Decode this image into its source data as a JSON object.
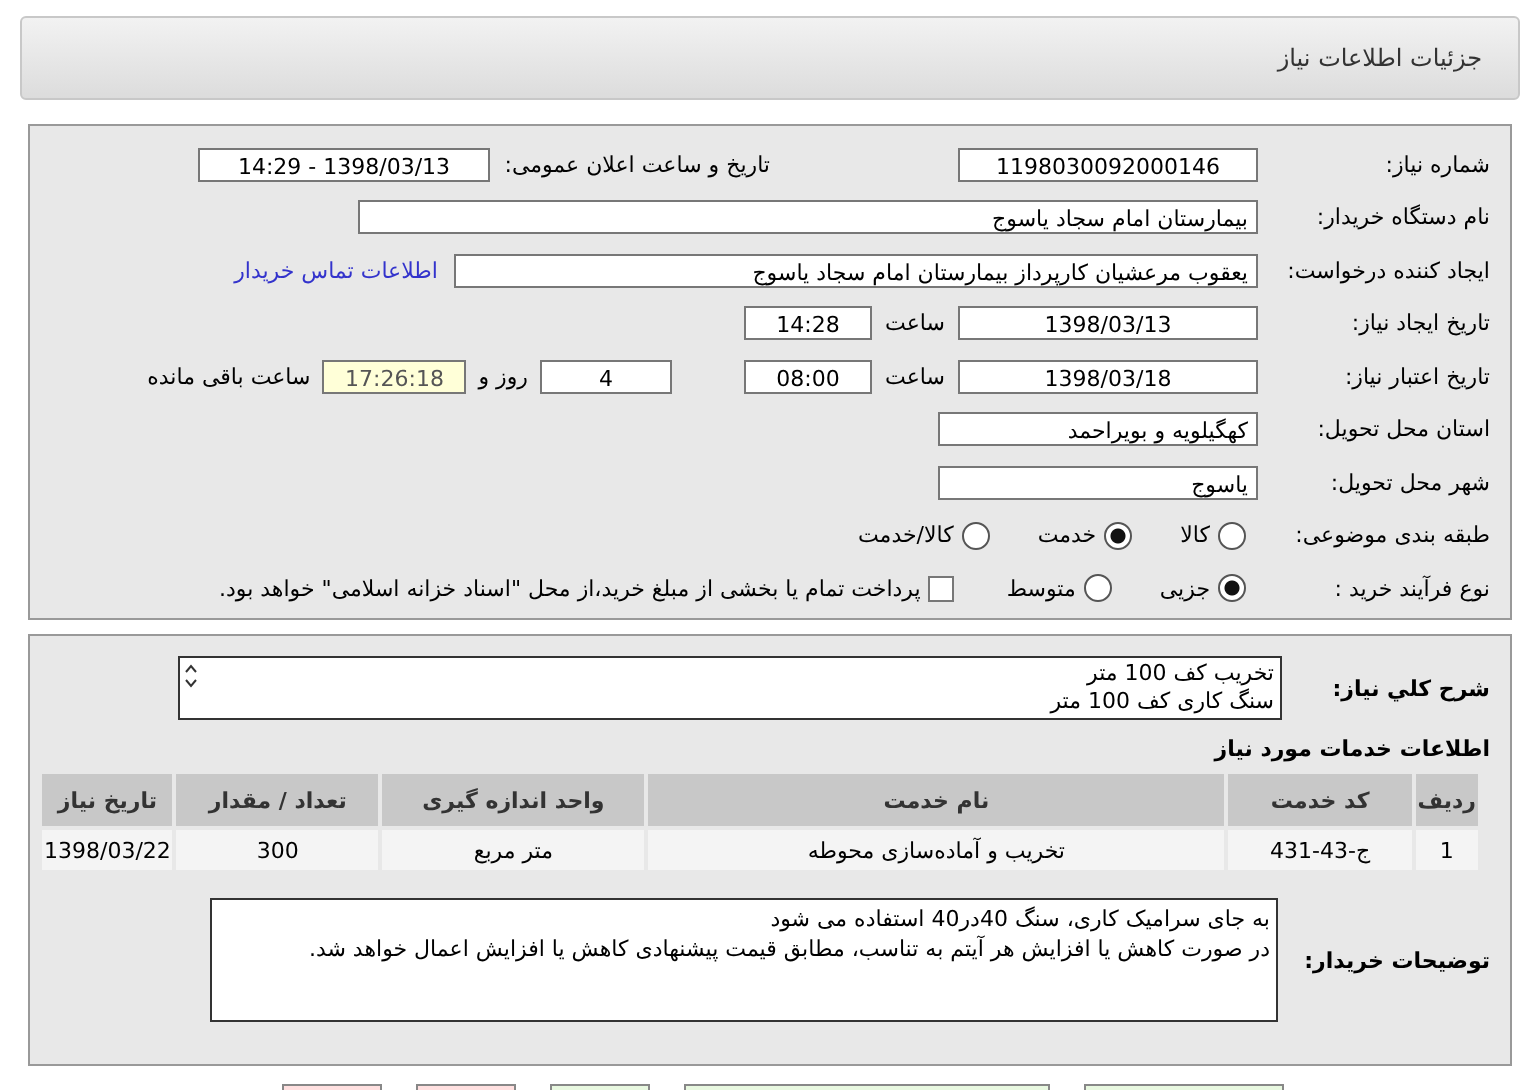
{
  "header": {
    "title": "جزئیات اطلاعات نیاز"
  },
  "need_number": {
    "label": "شماره نیاز:",
    "value": "1198030092000146"
  },
  "announce": {
    "label": "تاریخ و ساعت اعلان عمومی:",
    "value": "1398/03/13 - 14:29"
  },
  "buyer_org": {
    "label": "نام دستگاه خریدار:",
    "value": "بیمارستان امام سجاد یاسوج"
  },
  "creator": {
    "label": "ایجاد کننده درخواست:",
    "value": "یعقوب مرعشیان کارپرداز بیمارستان امام سجاد یاسوج",
    "link": "اطلاعات تماس خریدار"
  },
  "created": {
    "label": "تاریخ ایجاد نیاز:",
    "date": "1398/03/13",
    "time_label": "ساعت",
    "time": "14:28"
  },
  "validity": {
    "label": "تاریخ اعتبار نیاز:",
    "date": "1398/03/18",
    "time_label": "ساعت",
    "time": "08:00",
    "days": "4",
    "days_label": "روز و",
    "remaining": "17:26:18",
    "remaining_label": "ساعت باقی مانده"
  },
  "province": {
    "label": "استان محل تحویل:",
    "value": "کهگیلویه و بویراحمد"
  },
  "city": {
    "label": "شهر محل تحویل:",
    "value": "یاسوج"
  },
  "category": {
    "label": "طبقه بندی موضوعی:",
    "options": [
      {
        "label": "کالا",
        "selected": false
      },
      {
        "label": "خدمت",
        "selected": true
      },
      {
        "label": "کالا/خدمت",
        "selected": false
      }
    ]
  },
  "process": {
    "label": "نوع فرآیند خرید :",
    "options": [
      {
        "label": "جزیی",
        "selected": true
      },
      {
        "label": "متوسط",
        "selected": false
      }
    ],
    "payment": {
      "label": "پرداخت تمام یا بخشی از مبلغ خرید،از محل \"اسناد خزانه اسلامی\" خواهد بود.",
      "checked": false
    }
  },
  "summary": {
    "label": "شرح کلي نیاز:",
    "lines": [
      "تخریب کف 100 متر",
      "سنگ کاری کف 100 متر"
    ]
  },
  "services": {
    "title": "اطلاعات خدمات مورد نیاز",
    "columns": [
      "ردیف",
      "کد خدمت",
      "نام خدمت",
      "واحد اندازه گیری",
      "تعداد / مقدار",
      "تاریخ نیاز"
    ],
    "rows": [
      [
        "1",
        "ج-43-431",
        "تخریب و آماده‌سازی محوطه",
        "متر مربع",
        "300",
        "1398/03/22"
      ]
    ]
  },
  "notes": {
    "label": "توضیحات خریدار:",
    "paragraphs": [
      "به جای سرامیک کاری، سنگ 40در40 استفاده می شود",
      "در صورت کاهش یا افزایش هر آیتم به تناسب، مطابق قیمت پیشنهادی کاهش یا افزایش اعمال خواهد شد."
    ]
  },
  "buttons": [
    {
      "color": "#e8f8e0"
    },
    {
      "color": "#e8f8e0"
    },
    {
      "color": "#e8f8e0"
    },
    {
      "color": "#ffe0e0"
    },
    {
      "color": "#ffe0e0"
    }
  ]
}
